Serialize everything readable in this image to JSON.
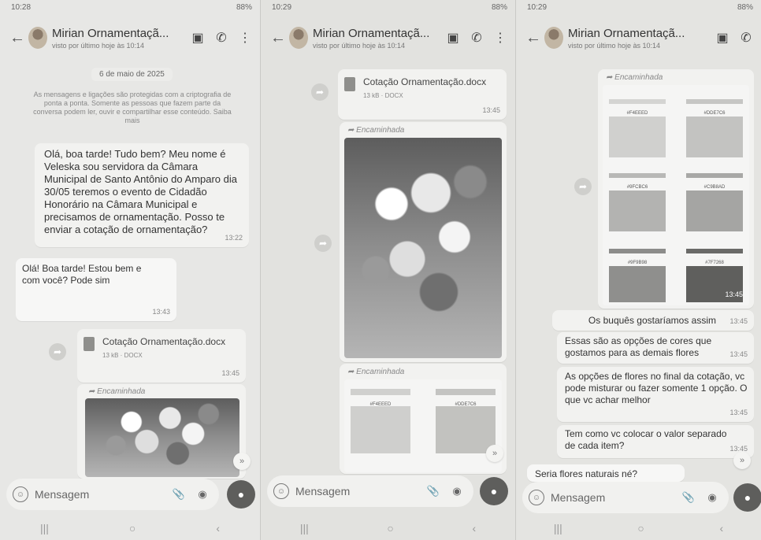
{
  "panels": [
    {
      "status_time": "10:28",
      "status_right": "88%",
      "title": "Mirian Ornamentaçã...",
      "subtitle": "visto por último hoje às 10:14",
      "date_chip": "6 de maio de 2025",
      "encryption_notice": "As mensagens e ligações são protegidas com a criptografia de ponta a ponta. Somente as pessoas que fazem parte da conversa podem ler, ouvir e compartilhar esse conteúdo. Saiba mais",
      "msg_out_1": "Olá, boa tarde! Tudo bem? Meu nome é Veleska sou servidora da Câmara Municipal de Santo Antônio do Amparo dia 30/05 teremos o evento de Cidadão Honorário na Câmara Municipal e precisamos de ornamentação. Posso te enviar a cotação de ornamentação?",
      "msg_out_1_time": "13:22",
      "msg_in_1": "Olá! Boa tarde! Estou bem e com você? Pode sim",
      "msg_in_1_time": "13:43",
      "doc_name": "Cotação Ornamentação.docx",
      "doc_meta": "13 kB · DOCX",
      "doc_time": "13:45",
      "forwarded_label": "Encaminhada",
      "input_placeholder": "Mensagem"
    },
    {
      "status_time": "10:29",
      "status_right": "88%",
      "title": "Mirian Ornamentaçã...",
      "subtitle": "visto por último hoje às 10:14",
      "doc_name": "Cotação Ornamentação.docx",
      "doc_meta": "13 kB · DOCX",
      "doc_time": "13:45",
      "forwarded_label_1": "Encaminhada",
      "forwarded_label_2": "Encaminhada",
      "palette_labels": [
        "#F4EEED",
        "#DDE7C6"
      ],
      "input_placeholder": "Mensagem"
    },
    {
      "status_time": "10:29",
      "status_right": "88%",
      "title": "Mirian Ornamentaçã...",
      "subtitle": "visto por último hoje às 10:14",
      "forwarded_label": "Encaminhada",
      "palette_labels": [
        "#F4EEED",
        "#DDE7C6",
        "#9FCBC6",
        "#C9B8AD",
        "#9F9B98",
        "#7F7268"
      ],
      "palette_time": "13:45",
      "msg_1": "Os buquês gostaríamos assim",
      "msg_1_time": "13:45",
      "msg_2": "Essas são as opções de cores que gostamos para as demais flores",
      "msg_2_time": "13:45",
      "msg_3": "As opções de flores no final da cotação, vc pode misturar ou fazer somente 1 opção. O que vc achar melhor",
      "msg_3_time": "13:45",
      "msg_4": "Tem como vc colocar o valor separado de cada item?",
      "msg_4_time": "13:45",
      "msg_5": "Seria flores naturais né?",
      "input_placeholder": "Mensagem"
    }
  ]
}
